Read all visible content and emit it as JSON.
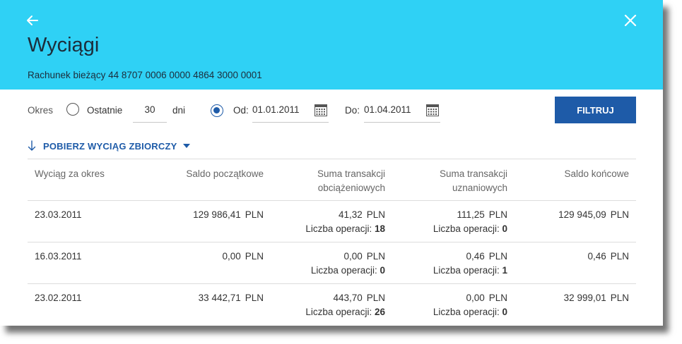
{
  "header": {
    "title": "Wyciągi",
    "account": "Rachunek bieżący 44 8707 0006 0000 4864 3000 0001",
    "bg_color": "#2fd1f5"
  },
  "filters": {
    "period_label": "Okres",
    "last_label": "Ostatnie",
    "days_value": "30",
    "days_unit": "dni",
    "from_label": "Od:",
    "from_value": "01.01.2011",
    "to_label": "Do:",
    "to_value": "01.04.2011",
    "selected": "range",
    "filter_button": "FILTRUJ",
    "accent_color": "#1e5ba8"
  },
  "download": {
    "label": "POBIERZ WYCIĄG ZBIORCZY"
  },
  "table": {
    "headers": {
      "period": "Wyciąg za okres",
      "opening": "Saldo początkowe",
      "debit_1": "Suma transakcji",
      "debit_2": "obciążeniowych",
      "credit_1": "Suma transakcji",
      "credit_2": "uznaniowych",
      "closing": "Saldo końcowe"
    },
    "ops_label": "Liczba operacji:",
    "rows": [
      {
        "date": "23.03.2011",
        "opening": "129 986,41",
        "debit": "41,32",
        "debit_ops": "18",
        "credit": "111,25",
        "credit_ops": "0",
        "closing": "129 945,09",
        "currency": "PLN"
      },
      {
        "date": "16.03.2011",
        "opening": "0,00",
        "debit": "0,00",
        "debit_ops": "0",
        "credit": "0,46",
        "credit_ops": "1",
        "closing": "0,46",
        "currency": "PLN"
      },
      {
        "date": "23.02.2011",
        "opening": "33 442,71",
        "debit": "443,70",
        "debit_ops": "26",
        "credit": "0,00",
        "credit_ops": "0",
        "closing": "32 999,01",
        "currency": "PLN"
      }
    ]
  }
}
